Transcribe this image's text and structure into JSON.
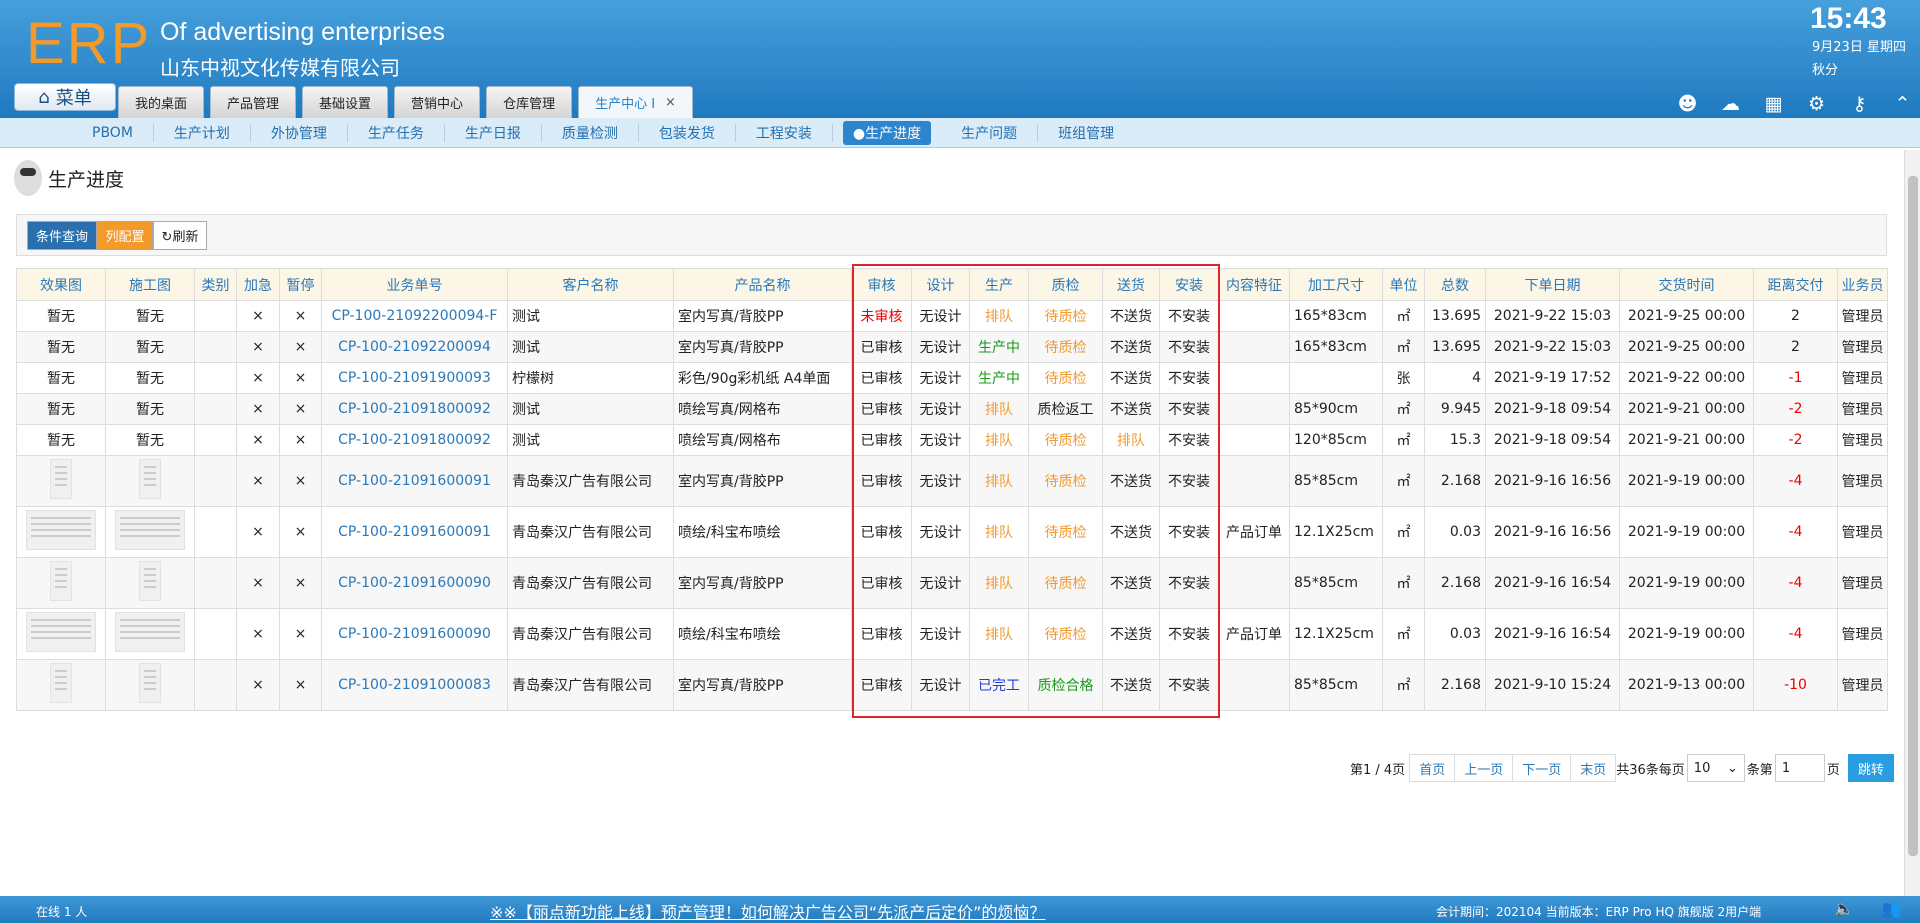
{
  "header": {
    "logo": "ERP",
    "company_en": "Of advertising enterprises",
    "company_cn": "山东中视文化传媒有限公司",
    "time": "15:43",
    "date": "9月23日 星期四",
    "solar_term": "秋分",
    "menu_label": "菜单",
    "tabs": [
      {
        "label": "我的桌面"
      },
      {
        "label": "产品管理"
      },
      {
        "label": "基础设置"
      },
      {
        "label": "营销中心"
      },
      {
        "label": "仓库管理"
      },
      {
        "label": "生产中心 I"
      }
    ],
    "tab_close": "×",
    "icons": [
      "user-icon",
      "cloud-upload-icon",
      "grid-icon",
      "gear-icon",
      "key-icon",
      "collapse-icon"
    ]
  },
  "subnav": [
    "PBOM",
    "生产计划",
    "外协管理",
    "生产任务",
    "生产日报",
    "质量检测",
    "包装发货",
    "工程安装",
    "●生产进度",
    "生产问题",
    "班组管理"
  ],
  "page": {
    "title": "生产进度",
    "btn_query": "条件查询",
    "btn_columns": "列配置",
    "btn_refresh": "刷新"
  },
  "table": {
    "headers": [
      "效果图",
      "施工图",
      "类别",
      "加急",
      "暂停",
      "业务单号",
      "客户名称",
      "产品名称",
      "审核",
      "设计",
      "生产",
      "质检",
      "送货",
      "安装",
      "内容特征",
      "加工尺寸",
      "单位",
      "总数",
      "下单日期",
      "交货时间",
      "距离交付",
      "业务员"
    ],
    "rows": [
      {
        "img": "暂无",
        "work": "暂无",
        "cat": "",
        "urgent": "×",
        "pause": "×",
        "order": "CP-100-21092200094-F",
        "customer": "测试",
        "product": "室内写真/背胶PP",
        "audit": "未审核",
        "design": "无设计",
        "prod": "排队",
        "qc": "待质检",
        "ship": "不送货",
        "install": "不安装",
        "feature": "",
        "size": "165*83cm",
        "unit": "㎡",
        "total": "13.695",
        "order_date": "2021-9-22 15:03",
        "delivery": "2021-9-25 00:00",
        "remain": "2",
        "sales": "管理员"
      },
      {
        "img": "暂无",
        "work": "暂无",
        "cat": "",
        "urgent": "×",
        "pause": "×",
        "order": "CP-100-21092200094",
        "customer": "测试",
        "product": "室内写真/背胶PP",
        "audit": "已审核",
        "design": "无设计",
        "prod": "生产中",
        "qc": "待质检",
        "ship": "不送货",
        "install": "不安装",
        "feature": "",
        "size": "165*83cm",
        "unit": "㎡",
        "total": "13.695",
        "order_date": "2021-9-22 15:03",
        "delivery": "2021-9-25 00:00",
        "remain": "2",
        "sales": "管理员"
      },
      {
        "img": "暂无",
        "work": "暂无",
        "cat": "",
        "urgent": "×",
        "pause": "×",
        "order": "CP-100-21091900093",
        "customer": "柠檬树",
        "product": "彩色/90g彩机纸 A4单面",
        "audit": "已审核",
        "design": "无设计",
        "prod": "生产中",
        "qc": "待质检",
        "ship": "不送货",
        "install": "不安装",
        "feature": "",
        "size": "",
        "unit": "张",
        "total": "4",
        "order_date": "2021-9-19 17:52",
        "delivery": "2021-9-22 00:00",
        "remain": "-1",
        "sales": "管理员"
      },
      {
        "img": "暂无",
        "work": "暂无",
        "cat": "",
        "urgent": "×",
        "pause": "×",
        "order": "CP-100-21091800092",
        "customer": "测试",
        "product": "喷绘写真/网格布",
        "audit": "已审核",
        "design": "无设计",
        "prod": "排队",
        "qc": "质检返工",
        "ship": "不送货",
        "install": "不安装",
        "feature": "",
        "size": "85*90cm",
        "unit": "㎡",
        "total": "9.945",
        "order_date": "2021-9-18 09:54",
        "delivery": "2021-9-21 00:00",
        "remain": "-2",
        "sales": "管理员"
      },
      {
        "img": "暂无",
        "work": "暂无",
        "cat": "",
        "urgent": "×",
        "pause": "×",
        "order": "CP-100-21091800092",
        "customer": "测试",
        "product": "喷绘写真/网格布",
        "audit": "已审核",
        "design": "无设计",
        "prod": "排队",
        "qc": "待质检",
        "ship": "排队",
        "install": "不安装",
        "feature": "",
        "size": "120*85cm",
        "unit": "㎡",
        "total": "15.3",
        "order_date": "2021-9-18 09:54",
        "delivery": "2021-9-21 00:00",
        "remain": "-2",
        "sales": "管理员"
      },
      {
        "img": "",
        "work": "",
        "cat": "",
        "urgent": "×",
        "pause": "×",
        "order": "CP-100-21091600091",
        "customer": "青岛秦汉广告有限公司",
        "product": "室内写真/背胶PP",
        "audit": "已审核",
        "design": "无设计",
        "prod": "排队",
        "qc": "待质检",
        "ship": "不送货",
        "install": "不安装",
        "feature": "",
        "size": "85*85cm",
        "unit": "㎡",
        "total": "2.168",
        "order_date": "2021-9-16 16:56",
        "delivery": "2021-9-19 00:00",
        "remain": "-4",
        "sales": "管理员"
      },
      {
        "img": "",
        "work": "",
        "cat": "",
        "urgent": "×",
        "pause": "×",
        "order": "CP-100-21091600091",
        "customer": "青岛秦汉广告有限公司",
        "product": "喷绘/科宝布喷绘",
        "audit": "已审核",
        "design": "无设计",
        "prod": "排队",
        "qc": "待质检",
        "ship": "不送货",
        "install": "不安装",
        "feature": "产品订单",
        "size": "12.1X25cm",
        "unit": "㎡",
        "total": "0.03",
        "order_date": "2021-9-16 16:56",
        "delivery": "2021-9-19 00:00",
        "remain": "-4",
        "sales": "管理员"
      },
      {
        "img": "",
        "work": "",
        "cat": "",
        "urgent": "×",
        "pause": "×",
        "order": "CP-100-21091600090",
        "customer": "青岛秦汉广告有限公司",
        "product": "室内写真/背胶PP",
        "audit": "已审核",
        "design": "无设计",
        "prod": "排队",
        "qc": "待质检",
        "ship": "不送货",
        "install": "不安装",
        "feature": "",
        "size": "85*85cm",
        "unit": "㎡",
        "total": "2.168",
        "order_date": "2021-9-16 16:54",
        "delivery": "2021-9-19 00:00",
        "remain": "-4",
        "sales": "管理员"
      },
      {
        "img": "",
        "work": "",
        "cat": "",
        "urgent": "×",
        "pause": "×",
        "order": "CP-100-21091600090",
        "customer": "青岛秦汉广告有限公司",
        "product": "喷绘/科宝布喷绘",
        "audit": "已审核",
        "design": "无设计",
        "prod": "排队",
        "qc": "待质检",
        "ship": "不送货",
        "install": "不安装",
        "feature": "产品订单",
        "size": "12.1X25cm",
        "unit": "㎡",
        "total": "0.03",
        "order_date": "2021-9-16 16:54",
        "delivery": "2021-9-19 00:00",
        "remain": "-4",
        "sales": "管理员"
      },
      {
        "img": "",
        "work": "",
        "cat": "",
        "urgent": "×",
        "pause": "×",
        "order": "CP-100-21091000083",
        "customer": "青岛秦汉广告有限公司",
        "product": "室内写真/背胶PP",
        "audit": "已审核",
        "design": "无设计",
        "prod": "已完工",
        "qc": "质检合格",
        "ship": "不送货",
        "install": "不安装",
        "feature": "",
        "size": "85*85cm",
        "unit": "㎡",
        "total": "2.168",
        "order_date": "2021-9-10 15:24",
        "delivery": "2021-9-13 00:00",
        "remain": "-10",
        "sales": "管理员"
      }
    ]
  },
  "pagination": {
    "page_info": "第1 / 4页",
    "first": "首页",
    "prev": "上一页",
    "next": "下一页",
    "last": "末页",
    "total_text": "共36条每页",
    "per_page": "10",
    "per_page_suffix": "条第",
    "page_input": "1",
    "page_suffix": "页",
    "go": "跳转"
  },
  "footer": {
    "online": "在线 1 人",
    "notice": "※※【丽点新功能上线】预产管理！如何解决广告公司“先派产后定价”的烦恼？",
    "version": "会计期间：202104 当前版本：ERP Pro HQ 旗舰版 2用户端"
  },
  "colors": {
    "accent": "#2a78b8",
    "orange": "#f39a2b",
    "red": "#e00000",
    "green": "#1a9a1a",
    "blue": "#1e3ee0",
    "highlight": "#e0242c"
  }
}
